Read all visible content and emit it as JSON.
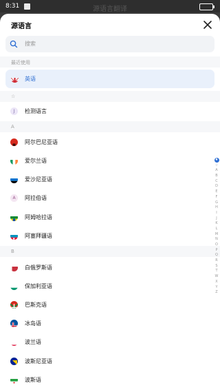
{
  "status_bar": {
    "time": "8:31"
  },
  "background_title": "源语言翻译",
  "sheet": {
    "title": "源语言",
    "search": {
      "placeholder": "搜索"
    }
  },
  "sections": {
    "recent": "最近使用",
    "star": "☆",
    "a": "A",
    "b": "B"
  },
  "recent": [
    {
      "label": "英语",
      "flag": "gb",
      "selected": true
    }
  ],
  "starred": [
    {
      "label": "检测语言",
      "flag": "detect",
      "icon_letter": "J"
    }
  ],
  "languages_a": [
    {
      "label": "阿尔巴尼亚语",
      "flag": "al"
    },
    {
      "label": "爱尔兰语",
      "flag": "ie"
    },
    {
      "label": "爱沙尼亚语",
      "flag": "ee"
    },
    {
      "label": "阿拉伯语",
      "flag": "ar",
      "icon_letter": "A"
    },
    {
      "label": "阿姆哈拉语",
      "flag": "et"
    },
    {
      "label": "阿塞拜疆语",
      "flag": "az"
    }
  ],
  "languages_b": [
    {
      "label": "白俄罗斯语",
      "flag": "by"
    },
    {
      "label": "保加利亚语",
      "flag": "bg"
    },
    {
      "label": "巴斯克语",
      "flag": "eus"
    },
    {
      "label": "冰岛语",
      "flag": "is"
    },
    {
      "label": "波兰语",
      "flag": "pl"
    },
    {
      "label": "波斯尼亚语",
      "flag": "ba"
    },
    {
      "label": "波斯语",
      "flag": "ir"
    }
  ],
  "index_bar": [
    "♦",
    "☆",
    "A",
    "B",
    "C",
    "D",
    "E",
    "F",
    "G",
    "H",
    "I",
    "J",
    "K",
    "L",
    "M",
    "N",
    "O",
    "P",
    "Q",
    "R",
    "S",
    "T",
    "W",
    "X",
    "Y",
    "Z"
  ],
  "colors": {
    "accent": "#2f6fd3",
    "selected_bg": "#e9f0fb",
    "section_bg": "#f6f7f9"
  }
}
